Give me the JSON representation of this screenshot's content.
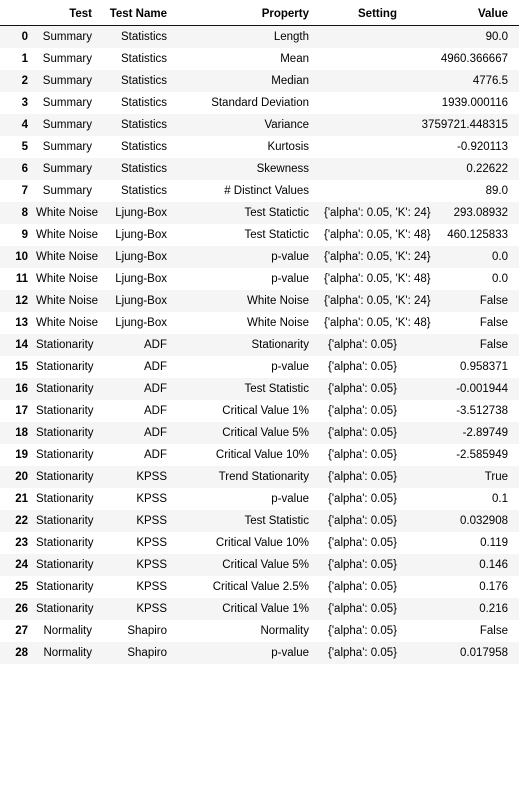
{
  "table": {
    "columns": [
      "Test",
      "Test Name",
      "Property",
      "Setting",
      "Value"
    ],
    "index_header": "",
    "rows": [
      {
        "index": "0",
        "test": "Summary",
        "test_name": "Statistics",
        "property": "Length",
        "setting": "",
        "value": "90.0"
      },
      {
        "index": "1",
        "test": "Summary",
        "test_name": "Statistics",
        "property": "Mean",
        "setting": "",
        "value": "4960.366667"
      },
      {
        "index": "2",
        "test": "Summary",
        "test_name": "Statistics",
        "property": "Median",
        "setting": "",
        "value": "4776.5"
      },
      {
        "index": "3",
        "test": "Summary",
        "test_name": "Statistics",
        "property": "Standard Deviation",
        "setting": "",
        "value": "1939.000116"
      },
      {
        "index": "4",
        "test": "Summary",
        "test_name": "Statistics",
        "property": "Variance",
        "setting": "",
        "value": "3759721.448315"
      },
      {
        "index": "5",
        "test": "Summary",
        "test_name": "Statistics",
        "property": "Kurtosis",
        "setting": "",
        "value": "-0.920113"
      },
      {
        "index": "6",
        "test": "Summary",
        "test_name": "Statistics",
        "property": "Skewness",
        "setting": "",
        "value": "0.22622"
      },
      {
        "index": "7",
        "test": "Summary",
        "test_name": "Statistics",
        "property": "# Distinct Values",
        "setting": "",
        "value": "89.0"
      },
      {
        "index": "8",
        "test": "White Noise",
        "test_name": "Ljung-Box",
        "property": "Test Statictic",
        "setting": "{'alpha': 0.05, 'K': 24}",
        "value": "293.08932"
      },
      {
        "index": "9",
        "test": "White Noise",
        "test_name": "Ljung-Box",
        "property": "Test Statictic",
        "setting": "{'alpha': 0.05, 'K': 48}",
        "value": "460.125833"
      },
      {
        "index": "10",
        "test": "White Noise",
        "test_name": "Ljung-Box",
        "property": "p-value",
        "setting": "{'alpha': 0.05, 'K': 24}",
        "value": "0.0"
      },
      {
        "index": "11",
        "test": "White Noise",
        "test_name": "Ljung-Box",
        "property": "p-value",
        "setting": "{'alpha': 0.05, 'K': 48}",
        "value": "0.0"
      },
      {
        "index": "12",
        "test": "White Noise",
        "test_name": "Ljung-Box",
        "property": "White Noise",
        "setting": "{'alpha': 0.05, 'K': 24}",
        "value": "False"
      },
      {
        "index": "13",
        "test": "White Noise",
        "test_name": "Ljung-Box",
        "property": "White Noise",
        "setting": "{'alpha': 0.05, 'K': 48}",
        "value": "False"
      },
      {
        "index": "14",
        "test": "Stationarity",
        "test_name": "ADF",
        "property": "Stationarity",
        "setting": "{'alpha': 0.05}",
        "value": "False"
      },
      {
        "index": "15",
        "test": "Stationarity",
        "test_name": "ADF",
        "property": "p-value",
        "setting": "{'alpha': 0.05}",
        "value": "0.958371"
      },
      {
        "index": "16",
        "test": "Stationarity",
        "test_name": "ADF",
        "property": "Test Statistic",
        "setting": "{'alpha': 0.05}",
        "value": "-0.001944"
      },
      {
        "index": "17",
        "test": "Stationarity",
        "test_name": "ADF",
        "property": "Critical Value 1%",
        "setting": "{'alpha': 0.05}",
        "value": "-3.512738"
      },
      {
        "index": "18",
        "test": "Stationarity",
        "test_name": "ADF",
        "property": "Critical Value 5%",
        "setting": "{'alpha': 0.05}",
        "value": "-2.89749"
      },
      {
        "index": "19",
        "test": "Stationarity",
        "test_name": "ADF",
        "property": "Critical Value 10%",
        "setting": "{'alpha': 0.05}",
        "value": "-2.585949"
      },
      {
        "index": "20",
        "test": "Stationarity",
        "test_name": "KPSS",
        "property": "Trend Stationarity",
        "setting": "{'alpha': 0.05}",
        "value": "True"
      },
      {
        "index": "21",
        "test": "Stationarity",
        "test_name": "KPSS",
        "property": "p-value",
        "setting": "{'alpha': 0.05}",
        "value": "0.1"
      },
      {
        "index": "22",
        "test": "Stationarity",
        "test_name": "KPSS",
        "property": "Test Statistic",
        "setting": "{'alpha': 0.05}",
        "value": "0.032908"
      },
      {
        "index": "23",
        "test": "Stationarity",
        "test_name": "KPSS",
        "property": "Critical Value 10%",
        "setting": "{'alpha': 0.05}",
        "value": "0.119"
      },
      {
        "index": "24",
        "test": "Stationarity",
        "test_name": "KPSS",
        "property": "Critical Value 5%",
        "setting": "{'alpha': 0.05}",
        "value": "0.146"
      },
      {
        "index": "25",
        "test": "Stationarity",
        "test_name": "KPSS",
        "property": "Critical Value 2.5%",
        "setting": "{'alpha': 0.05}",
        "value": "0.176"
      },
      {
        "index": "26",
        "test": "Stationarity",
        "test_name": "KPSS",
        "property": "Critical Value 1%",
        "setting": "{'alpha': 0.05}",
        "value": "0.216"
      },
      {
        "index": "27",
        "test": "Normality",
        "test_name": "Shapiro",
        "property": "Normality",
        "setting": "{'alpha': 0.05}",
        "value": "False"
      },
      {
        "index": "28",
        "test": "Normality",
        "test_name": "Shapiro",
        "property": "p-value",
        "setting": "{'alpha': 0.05}",
        "value": "0.017958"
      }
    ]
  },
  "colors": {
    "stripe": "#f5f5f5",
    "background": "#ffffff",
    "text": "#000000",
    "header_rule": "#111111"
  }
}
